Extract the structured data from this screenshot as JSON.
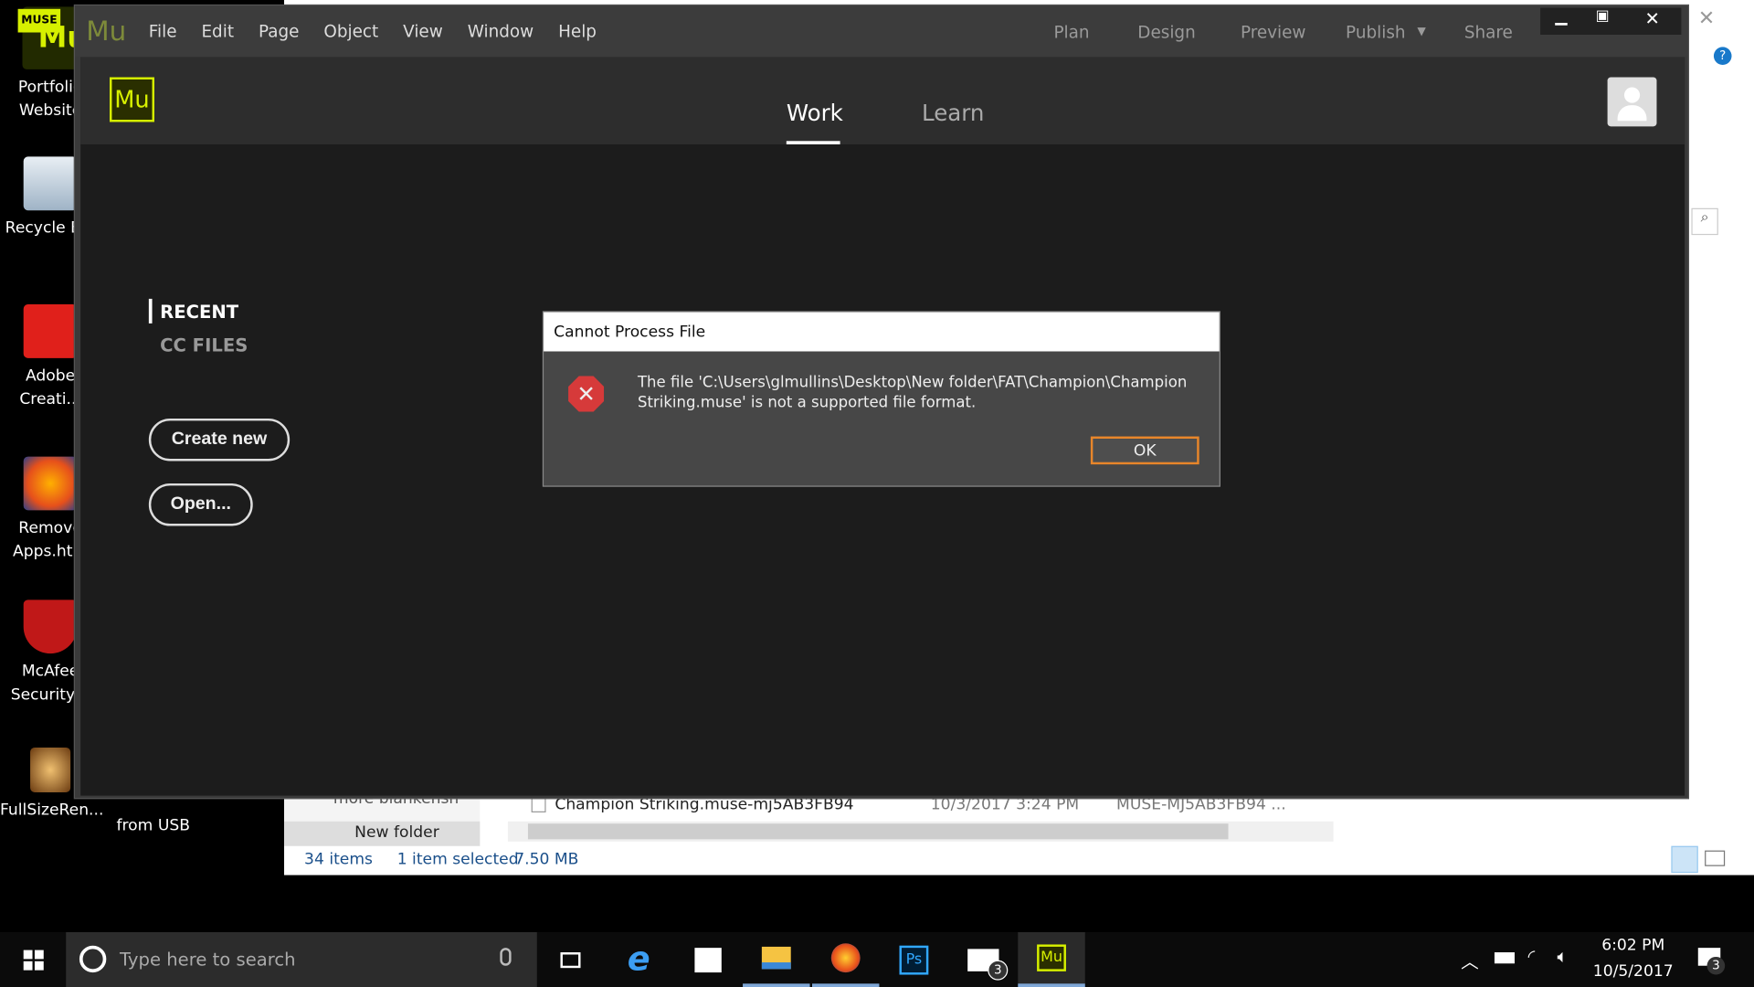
{
  "desktop": {
    "icons": [
      {
        "label": "Portfolio Website",
        "badge": "MUSE",
        "icon": "muse-file-icon"
      },
      {
        "label": "Recycle Bin",
        "icon": "recycle-bin-icon"
      },
      {
        "label": "Adobe Creati...",
        "icon": "adobe-cc-icon"
      },
      {
        "label": "Remove Apps.htm",
        "icon": "firefox-icon"
      },
      {
        "label": "McAfee Security S",
        "icon": "mcafee-icon"
      },
      {
        "label": "FullSizeRen...",
        "icon": "image-icon"
      },
      {
        "label": "from USB",
        "icon": "folder-icon"
      }
    ]
  },
  "explorer": {
    "folders": [
      "more blankensh",
      "New folder"
    ],
    "file": {
      "name": "Champion Striking.muse-mj5AB3FB94",
      "date": "10/3/2017 3:24 PM",
      "type": "MUSE-MJ5AB3FB94 ..."
    },
    "status": {
      "items": "34 items",
      "selected": "1 item selected",
      "size": "7.50 MB"
    }
  },
  "muse": {
    "logo": "Mu",
    "menu": [
      "File",
      "Edit",
      "Page",
      "Object",
      "View",
      "Window",
      "Help"
    ],
    "modes": [
      "Plan",
      "Design",
      "Preview",
      "Publish",
      "Share"
    ],
    "tabs": [
      "Work",
      "Learn"
    ],
    "active_tab": "Work",
    "side": {
      "recent": "RECENT",
      "cc_files": "CC FILES"
    },
    "buttons": {
      "create": "Create new",
      "open": "Open..."
    },
    "accent": "#d7f000"
  },
  "dialog": {
    "title": "Cannot Process File",
    "message": "The file 'C:\\Users\\glmullins\\Desktop\\New folder\\FAT\\Champion\\Champion Striking.muse' is not a supported file format.",
    "ok": "OK",
    "icon": "error-icon"
  },
  "taskbar": {
    "search_placeholder": "Type here to search",
    "time": "6:02 PM",
    "date": "10/5/2017",
    "notifications": "3",
    "mail_badge": "3"
  }
}
